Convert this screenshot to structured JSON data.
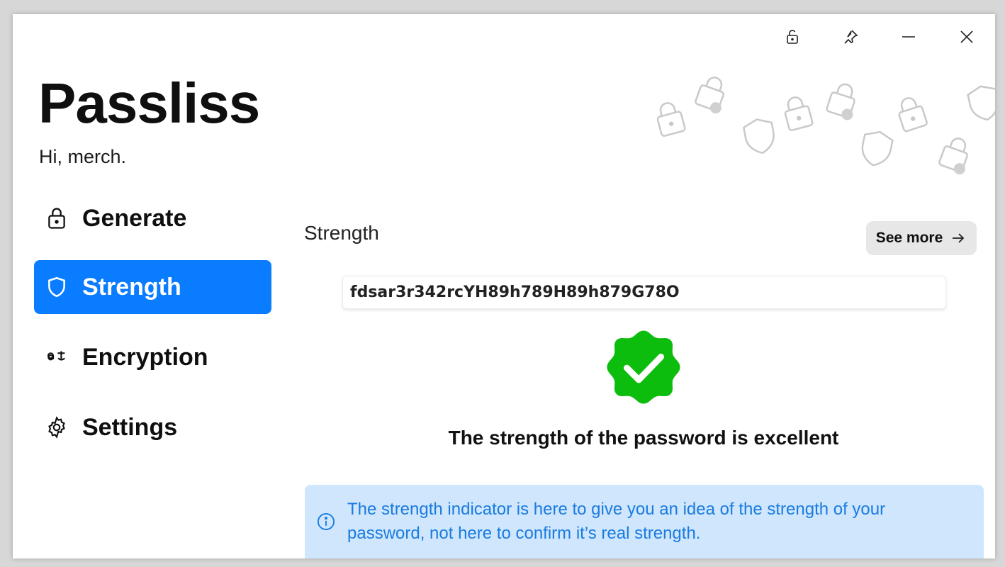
{
  "app": {
    "title": "Passliss",
    "greeting": "Hi, merch."
  },
  "titlebar": {
    "icons": [
      "lock-icon",
      "pin-icon",
      "minimize-icon",
      "close-icon"
    ]
  },
  "sidebar": {
    "items": [
      {
        "label": "Generate",
        "icon": "lock-icon",
        "active": false
      },
      {
        "label": "Strength",
        "icon": "shield-icon",
        "active": true
      },
      {
        "label": "Encryption",
        "icon": "translate-icon",
        "active": false
      },
      {
        "label": "Settings",
        "icon": "gear-icon",
        "active": false
      }
    ]
  },
  "main": {
    "section_title": "Strength",
    "see_more_label": "See more",
    "password_value": "fdsar3r342rcYH89h789H89h879G78O",
    "result_text": "The strength of the password is excellent",
    "info_text": "The strength indicator is here to give you an idea of the strength of your password, not here to confirm it’s real strength."
  },
  "colors": {
    "accent": "#0a7cff",
    "success": "#0dbd0d",
    "info_bg": "#cfe6fd",
    "info_text": "#1a7be0"
  }
}
